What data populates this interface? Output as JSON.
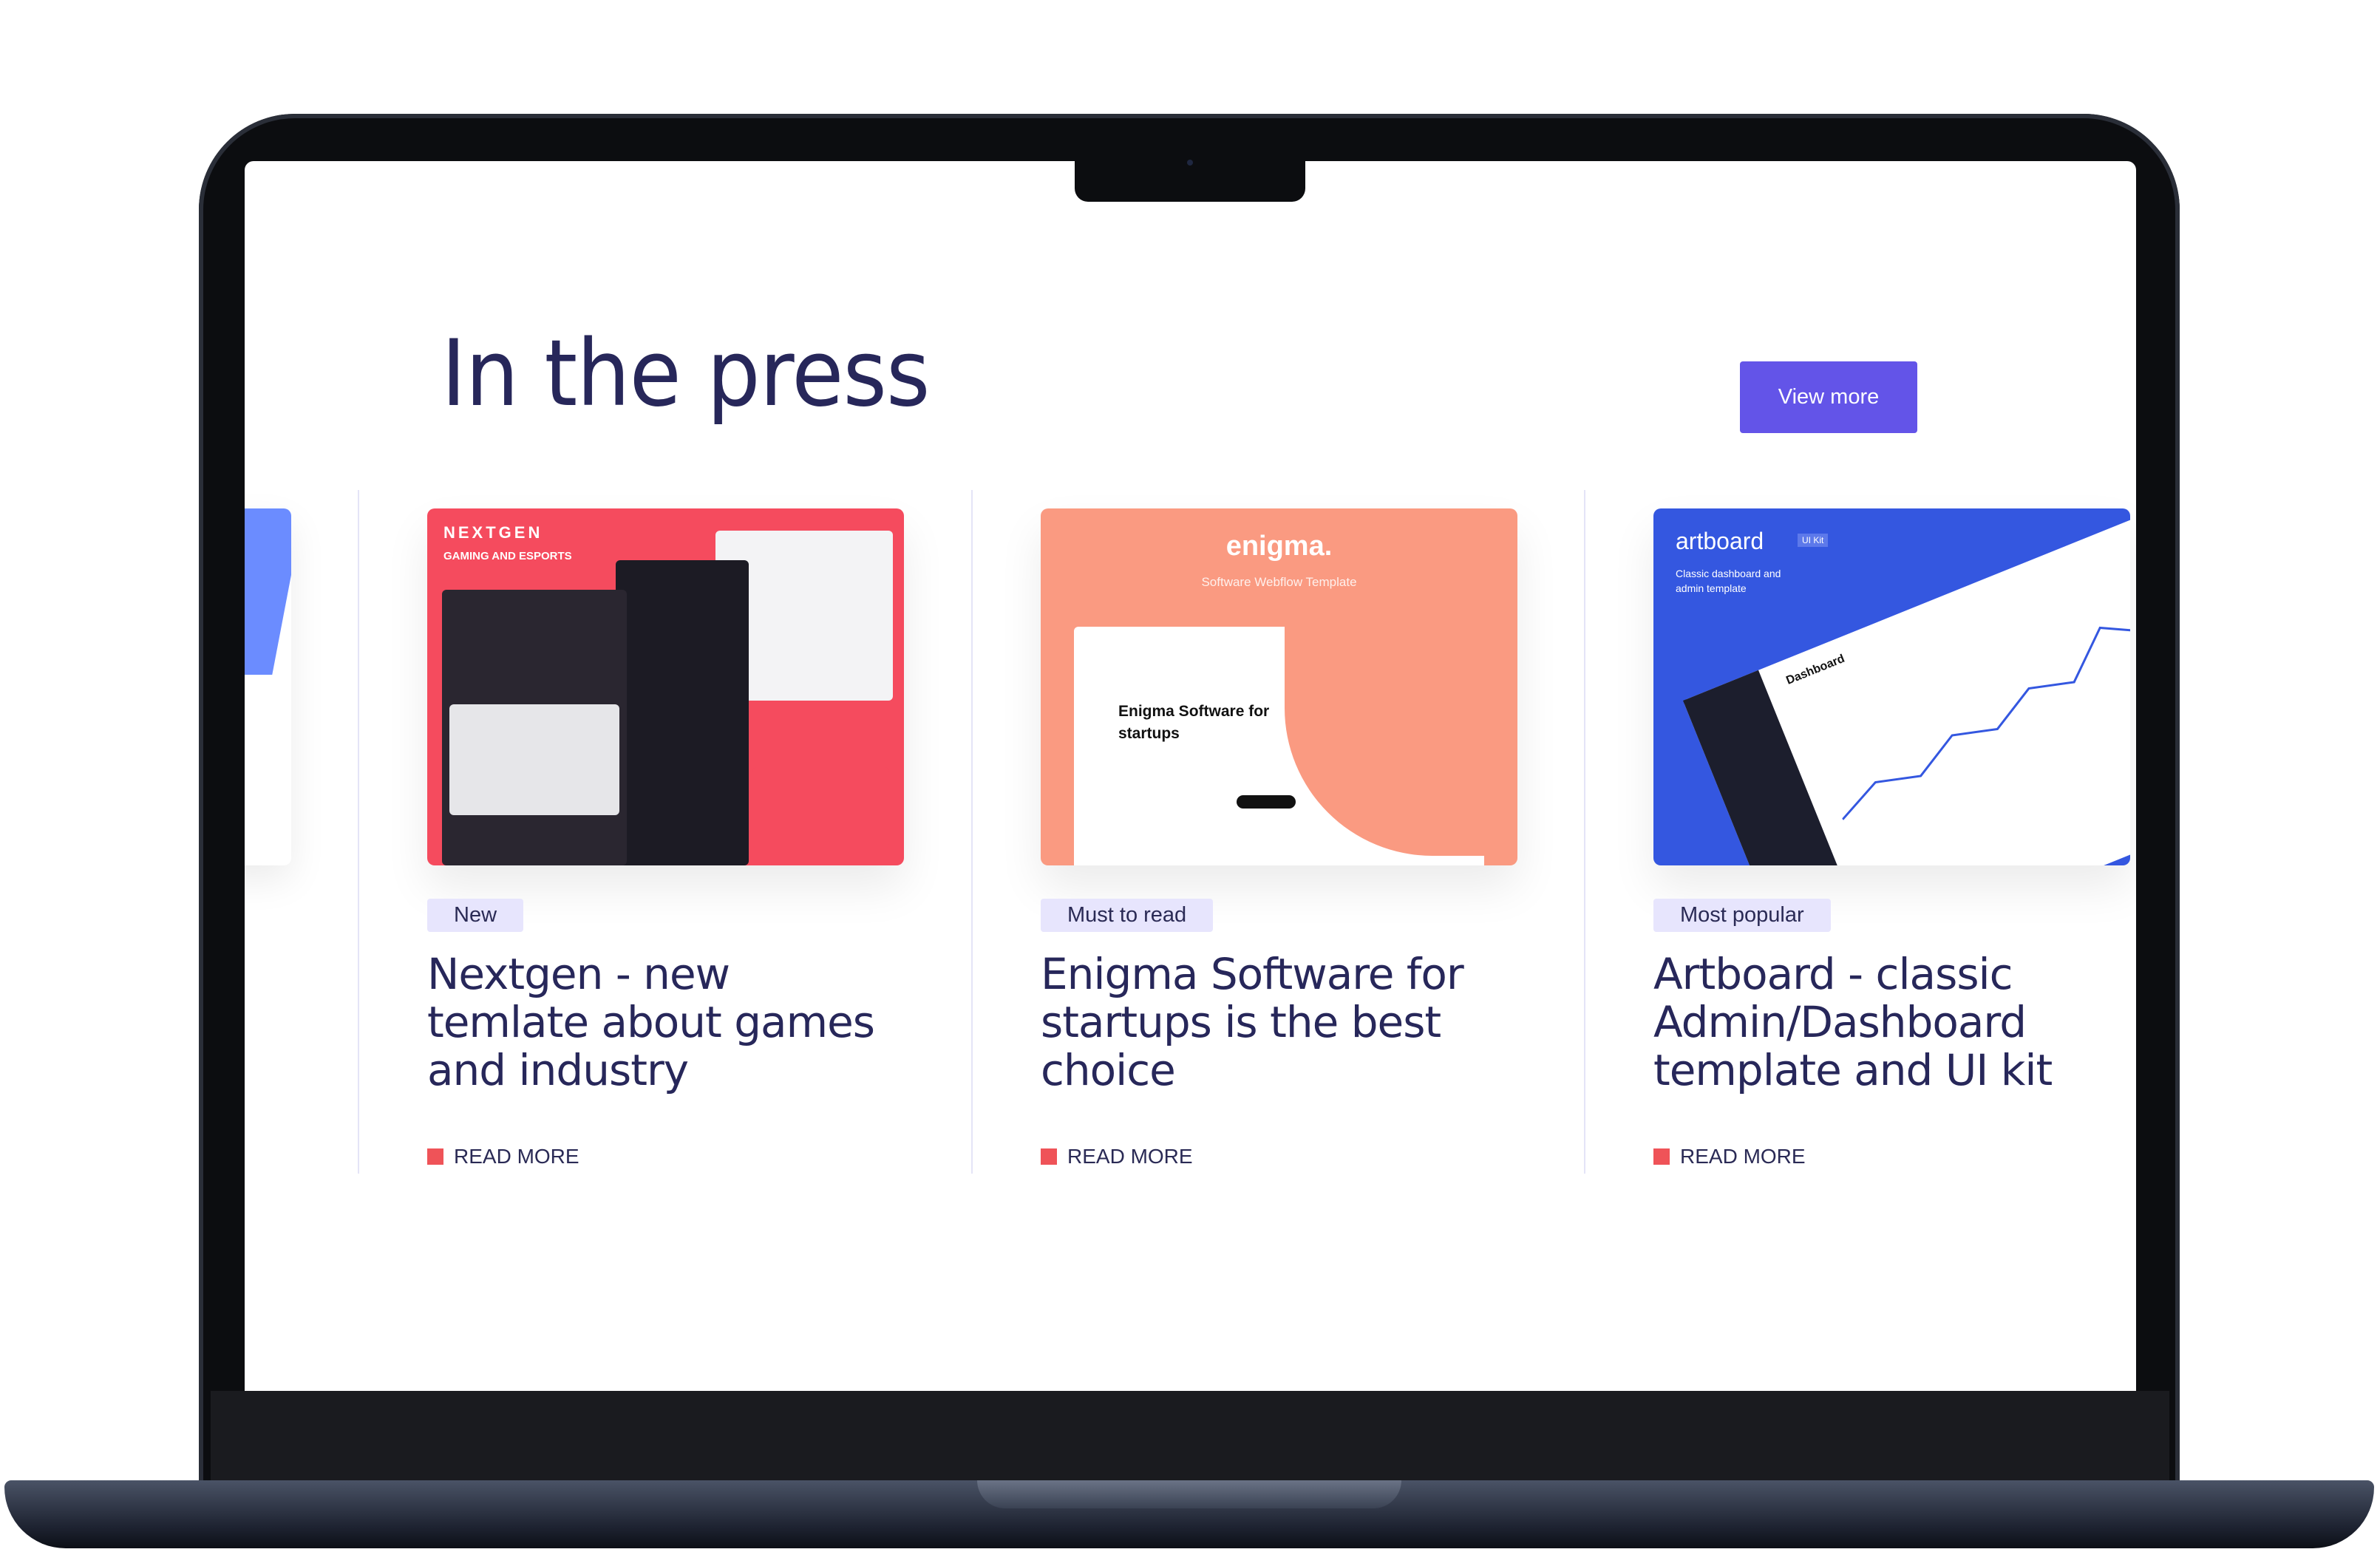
{
  "header": {
    "title": "In the press",
    "view_more_label": "View more"
  },
  "cards": [
    {
      "badge": "New",
      "title": "Nextgen - new temlate about games and industry",
      "read_more": "READ MORE",
      "image": {
        "brand": "NEXTGEN",
        "subtitle": "GAMING AND ESPORTS",
        "bg": "#f54b5e"
      }
    },
    {
      "badge": "Must to read",
      "title": "Enigma Software for startups is the best choice",
      "read_more": "READ MORE",
      "image": {
        "brand": "enigma.",
        "subtitle": "Software Webflow Template",
        "headline": "Enigma Software for startups",
        "bg": "#fa9a81"
      }
    },
    {
      "badge": "Most popular",
      "title": "Artboard - classic Admin/Dashboard template and UI kit",
      "read_more": "READ MORE",
      "image": {
        "brand": "artboard",
        "kit": "UI Kit",
        "subtitle": "Classic dashboard and admin template",
        "panel_title": "Dashboard",
        "bg": "#3457e0"
      }
    }
  ],
  "colors": {
    "accent": "#6354e8",
    "heading": "#27275a",
    "badge_bg": "#e7e5fd",
    "read_more_marker": "#ef5358"
  }
}
